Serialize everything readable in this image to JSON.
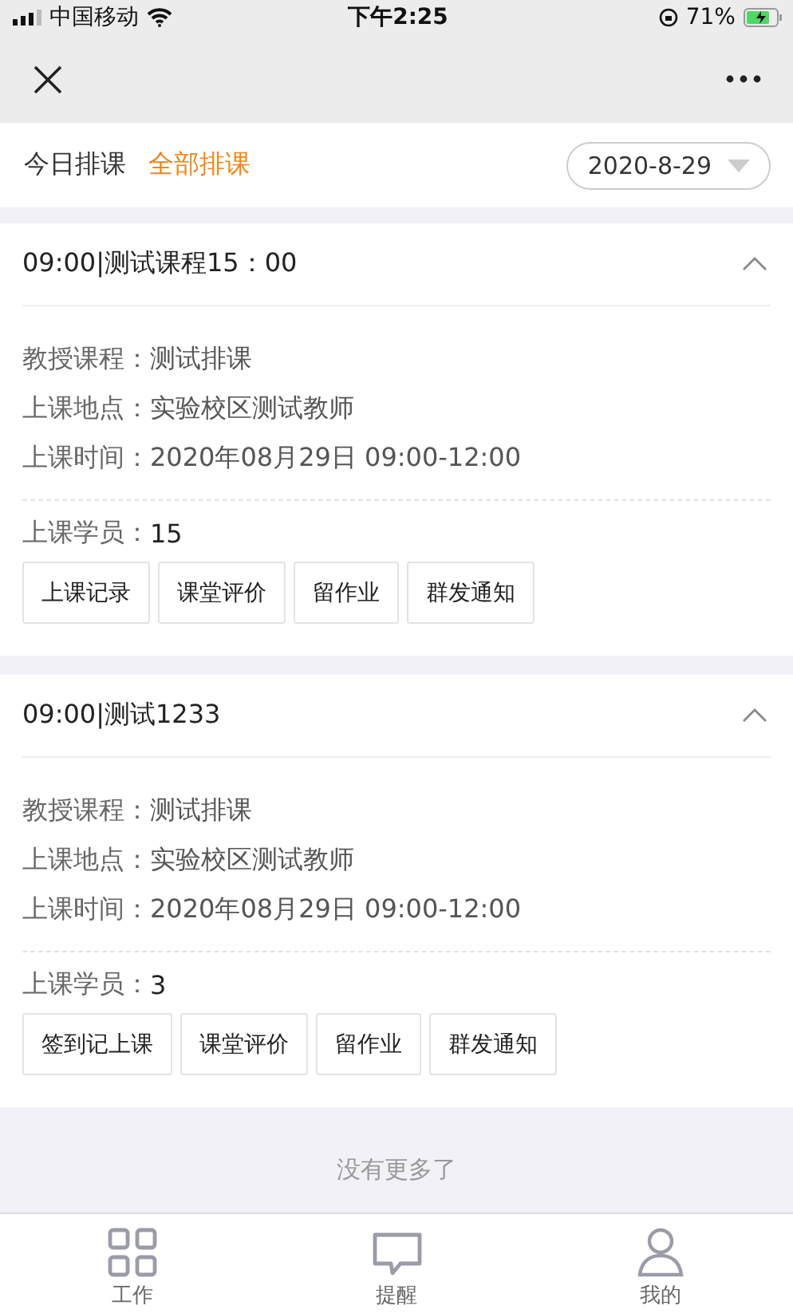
{
  "status_bar": {
    "carrier": "中国移动",
    "time": "下午2:25",
    "battery": "71%"
  },
  "header": {
    "tabs": [
      {
        "label": "今日排课",
        "selected": false
      },
      {
        "label": "全部排课",
        "selected": true
      }
    ],
    "date": "2020-8-29"
  },
  "lessons": [
    {
      "title": "09:00|测试课程15：00",
      "expanded": true,
      "fields": [
        {
          "label": "教授课程：",
          "value": "测试排课"
        },
        {
          "label": "上课地点：",
          "value": "实验校区测试教师"
        },
        {
          "label": "上课时间：",
          "value": "2020年08月29日 09:00-12:00"
        }
      ],
      "students_label": "上课学员：",
      "students": "15",
      "actions": [
        "上课记录",
        "课堂评价",
        "留作业",
        "群发通知"
      ]
    },
    {
      "title": "09:00|测试1233",
      "expanded": true,
      "fields": [
        {
          "label": "教授课程：",
          "value": "测试排课"
        },
        {
          "label": "上课地点：",
          "value": "实验校区测试教师"
        },
        {
          "label": "上课时间：",
          "value": "2020年08月29日 09:00-12:00"
        }
      ],
      "students_label": "上课学员：",
      "students": "3",
      "actions": [
        "签到记上课",
        "课堂评价",
        "留作业",
        "群发通知"
      ]
    }
  ],
  "footer_note": "没有更多了",
  "tab_bar": [
    {
      "label": "工作",
      "kind": "grid"
    },
    {
      "label": "提醒",
      "kind": "chat"
    },
    {
      "label": "我的",
      "kind": "person"
    }
  ]
}
